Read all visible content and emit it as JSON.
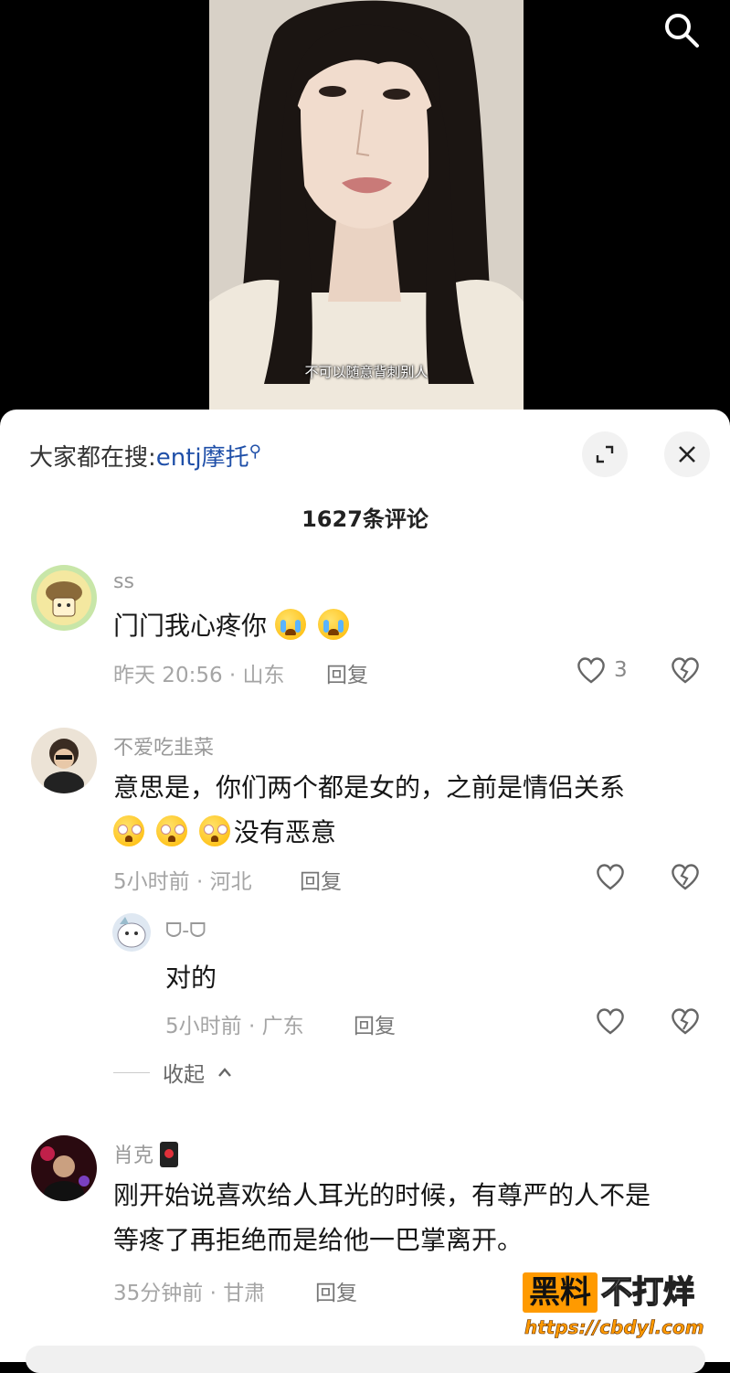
{
  "video": {
    "subtitle": "不可以随意背刺别人"
  },
  "header": {
    "hot_search_prefix": "大家都在搜:",
    "hot_search_keyword": "entj摩托",
    "comment_count": "1627条评论"
  },
  "comments": [
    {
      "username": "ss",
      "text": "门门我心疼你",
      "emoji_count": 2,
      "meta": "昨天 20:56 · 山东",
      "reply_label": "回复",
      "likes": "3"
    },
    {
      "username": "不爱吃韭菜",
      "text_line1": "意思是，你们两个都是女的，之前是情侣关系",
      "text_line2": "没有恶意",
      "emoji_count": 3,
      "meta": "5小时前 · 河北",
      "reply_label": "回复",
      "likes": ""
    },
    {
      "username": "肖克",
      "text_line1": "刚开始说喜欢给人耳光的时候，有尊严的人不是",
      "text_line2": "等疼了再拒绝而是给他一巴掌离开。",
      "meta": "35分钟前 · 甘肃",
      "reply_label": "回复"
    }
  ],
  "replies": [
    {
      "username": "ᗜ-ᗜ",
      "text": "对的",
      "meta": "5小时前 · 广东",
      "reply_label": "回复"
    }
  ],
  "collapse_label": "收起",
  "watermark": {
    "part1": "黑料",
    "part2": "不打烊",
    "url": "https://cbdyl.com"
  },
  "colors": {
    "keyword_blue": "#1f4fa8",
    "watermark_orange": "#ff9a00"
  }
}
